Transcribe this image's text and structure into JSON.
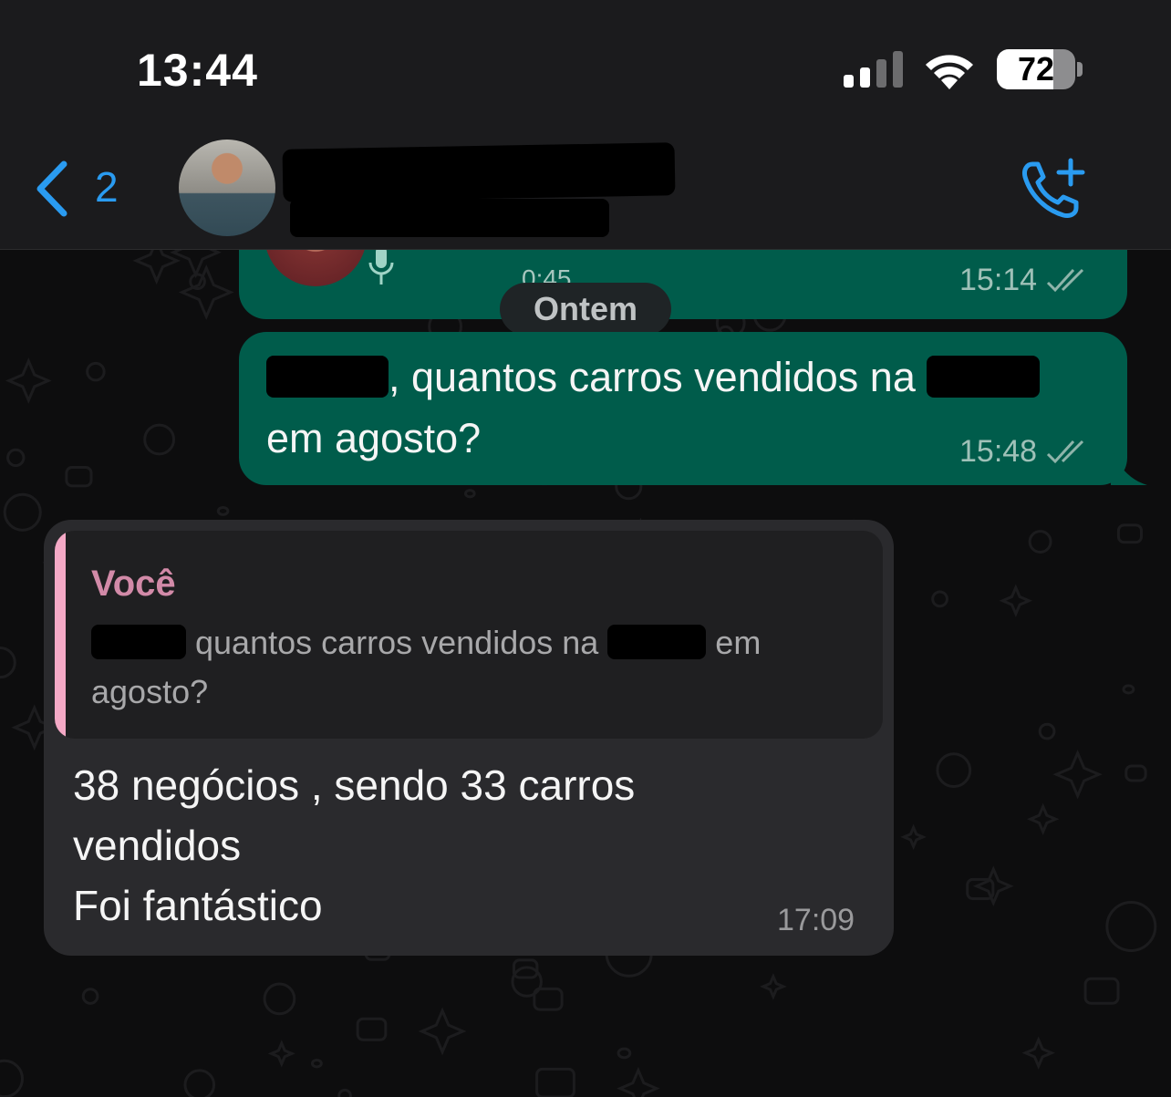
{
  "status_bar": {
    "time": "13:44",
    "battery": "72",
    "battery_level": 0.72,
    "signal_icon": "cellular-signal-icon",
    "wifi_icon": "wifi-icon"
  },
  "header": {
    "back_count": "2",
    "back_icon": "chevron-left-icon",
    "call_icon": "phone-add-icon"
  },
  "messages": {
    "audio": {
      "duration": "0:45",
      "time": "15:14"
    },
    "date_separator": "Ontem",
    "outgoing": {
      "line1_before": "",
      "line1_mid": ", quantos carros vendidos na ",
      "line2": "em agosto?",
      "time": "15:48"
    },
    "incoming": {
      "quote_author": "Você",
      "quote_mid": " quantos carros vendidos na ",
      "quote_end": " em",
      "quote_line2": "agosto?",
      "text": "38 negócios , sendo 33 carros\nvendidos\nFoi fantástico",
      "time": "17:09"
    }
  },
  "colors": {
    "outgoing_bubble": "#005c4b",
    "incoming_bubble": "#2a2a2d",
    "accent_blue": "#2a9bf0",
    "quote_bar": "#f4a9c6"
  }
}
